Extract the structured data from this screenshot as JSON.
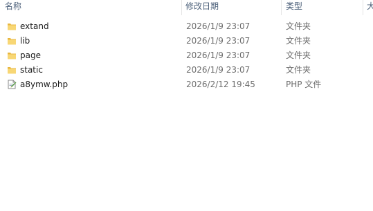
{
  "columns": {
    "name": "名称",
    "date": "修改日期",
    "type": "类型",
    "size": "大"
  },
  "files": [
    {
      "name": "extand",
      "date": "2026/1/9 23:07",
      "type": "文件夹",
      "icon": "folder-icon"
    },
    {
      "name": "lib",
      "date": "2026/1/9 23:07",
      "type": "文件夹",
      "icon": "folder-icon"
    },
    {
      "name": "page",
      "date": "2026/1/9 23:07",
      "type": "文件夹",
      "icon": "folder-icon"
    },
    {
      "name": "static",
      "date": "2026/1/9 23:07",
      "type": "文件夹",
      "icon": "folder-icon"
    },
    {
      "name": "a8ymw.php",
      "date": "2026/2/12 19:45",
      "type": "PHP 文件",
      "icon": "php-file-icon"
    }
  ],
  "colors": {
    "folder": "#f8d775",
    "folder_tab": "#e8b740",
    "header_text": "#4c607a"
  }
}
